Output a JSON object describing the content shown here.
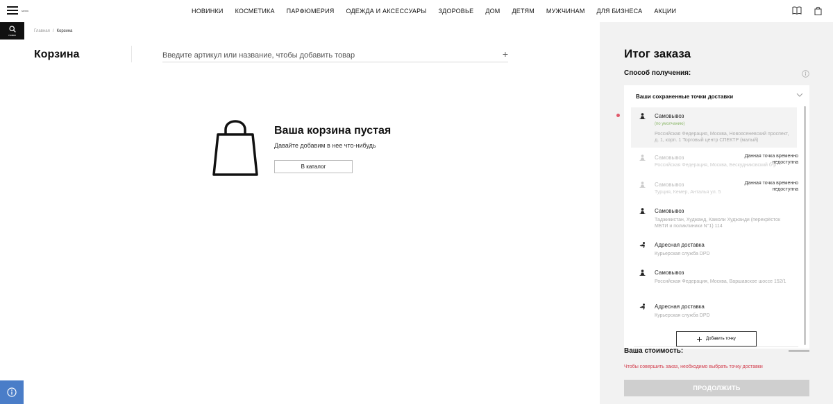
{
  "header": {
    "menu_label": "меню",
    "search_label": "поиск",
    "nav": [
      "НОВИНКИ",
      "КОСМЕТИКА",
      "ПАРФЮМЕРИЯ",
      "ОДЕЖДА И АКСЕССУАРЫ",
      "ЗДОРОВЬЕ",
      "ДОМ",
      "ДЕТЯМ",
      "МУЖЧИНАМ",
      "ДЛЯ БИЗНЕСА",
      "АКЦИИ"
    ],
    "icons": [
      "catalog-book-icon",
      "shopping-bag-icon"
    ]
  },
  "breadcrumb": {
    "home": "Главная",
    "separator": "/",
    "current": "Корзина"
  },
  "cart": {
    "title": "Корзина",
    "add_placeholder": "Введите артикул или название, чтобы добавить товар",
    "add_icon": "+",
    "empty_title": "Ваша корзина пустая",
    "empty_subtitle": "Давайте добавим в нее что-нибудь",
    "catalog_button": "В каталог"
  },
  "summary": {
    "title": "Итог заказа",
    "method_label": "Способ получения:",
    "dropdown_title": "Ваши сохраненные точки доставки",
    "options": [
      {
        "name": "Самовывоз",
        "default": "(по умолчанию)",
        "address": "Российская Федерация, Москва, Новоясеневский проспект, д. 1, корп. 1 Торговый центр СПЕКТР (малый)",
        "unavailable": "",
        "icon": "pickup-icon"
      },
      {
        "name": "Самовывоз",
        "default": "",
        "address": "Российская Федерация, Москва, Бескудниковский б-р",
        "unavailable": "Данная точка временно недоступна",
        "icon": "pickup-icon"
      },
      {
        "name": "Самовывоз",
        "default": "",
        "address": "Турция, Кемер, Анталья ул. 5",
        "unavailable": "Данная точка временно недоступна",
        "icon": "pickup-icon"
      },
      {
        "name": "Самовывоз",
        "default": "",
        "address": "Таджикистан, Худжанд, Камоли Худжанди (перекрёсток МБТИ и поликлиники N°1) 114",
        "unavailable": "",
        "icon": "pickup-icon"
      },
      {
        "name": "Адресная доставка",
        "default": "",
        "address": "Курьерская служба DPD",
        "unavailable": "",
        "icon": "courier-icon"
      },
      {
        "name": "Самовывоз",
        "default": "",
        "address": "Российская Федерация, Москва, Варшавское шоссе 152/1",
        "unavailable": "",
        "icon": "pickup-icon"
      },
      {
        "name": "Адресная доставка",
        "default": "",
        "address": "Курьерская служба DPD",
        "unavailable": "",
        "icon": "courier-icon"
      }
    ],
    "add_point_button": "Добавить точку",
    "cost_label": "Ваша стоимость:",
    "warning": "Чтобы совершить заказ, необходимо выбрать точку доставки",
    "proceed_button": "ПРОДОЛЖИТЬ"
  },
  "colors": {
    "accent_info": "#4a7dc8",
    "warning": "#d23b4b",
    "default_tag": "#8cb86a",
    "disabled_button": "#cfcfcf"
  }
}
